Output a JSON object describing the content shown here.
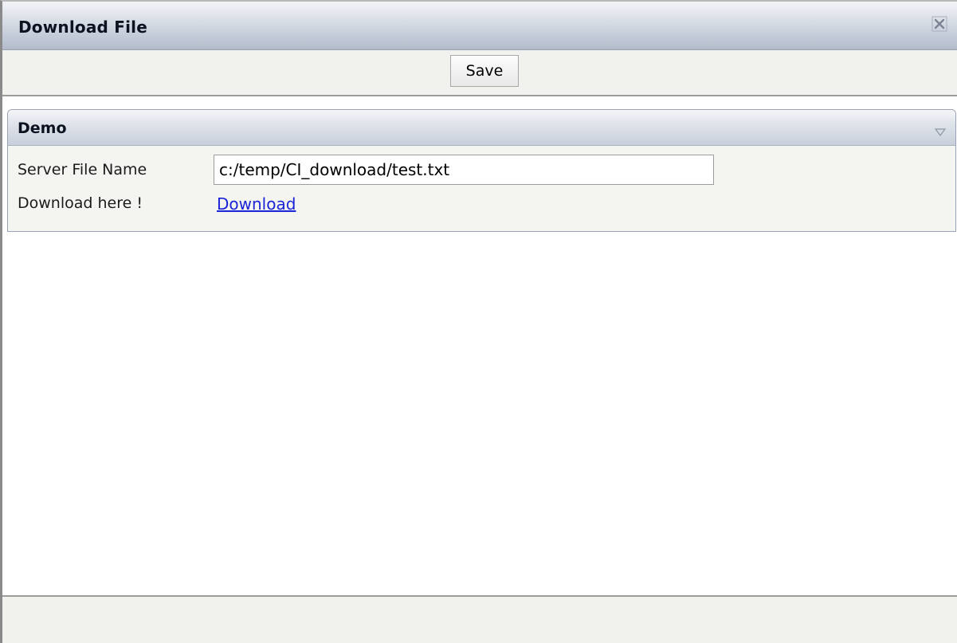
{
  "window": {
    "title": "Download File"
  },
  "toolbar": {
    "save_label": "Save"
  },
  "group": {
    "title": "Demo",
    "fields": {
      "server_file_name": {
        "label": "Server File Name",
        "value": "c:/temp/CI_download/test.txt"
      },
      "download": {
        "label": "Download here !",
        "link_text": "Download"
      }
    }
  },
  "icons": {
    "close": "close-icon",
    "collapse": "chevron-down-icon"
  },
  "colors": {
    "link": "#1a24d6",
    "header_gradient_end": "#b4bccb",
    "panel_background": "#f1f2ee"
  }
}
